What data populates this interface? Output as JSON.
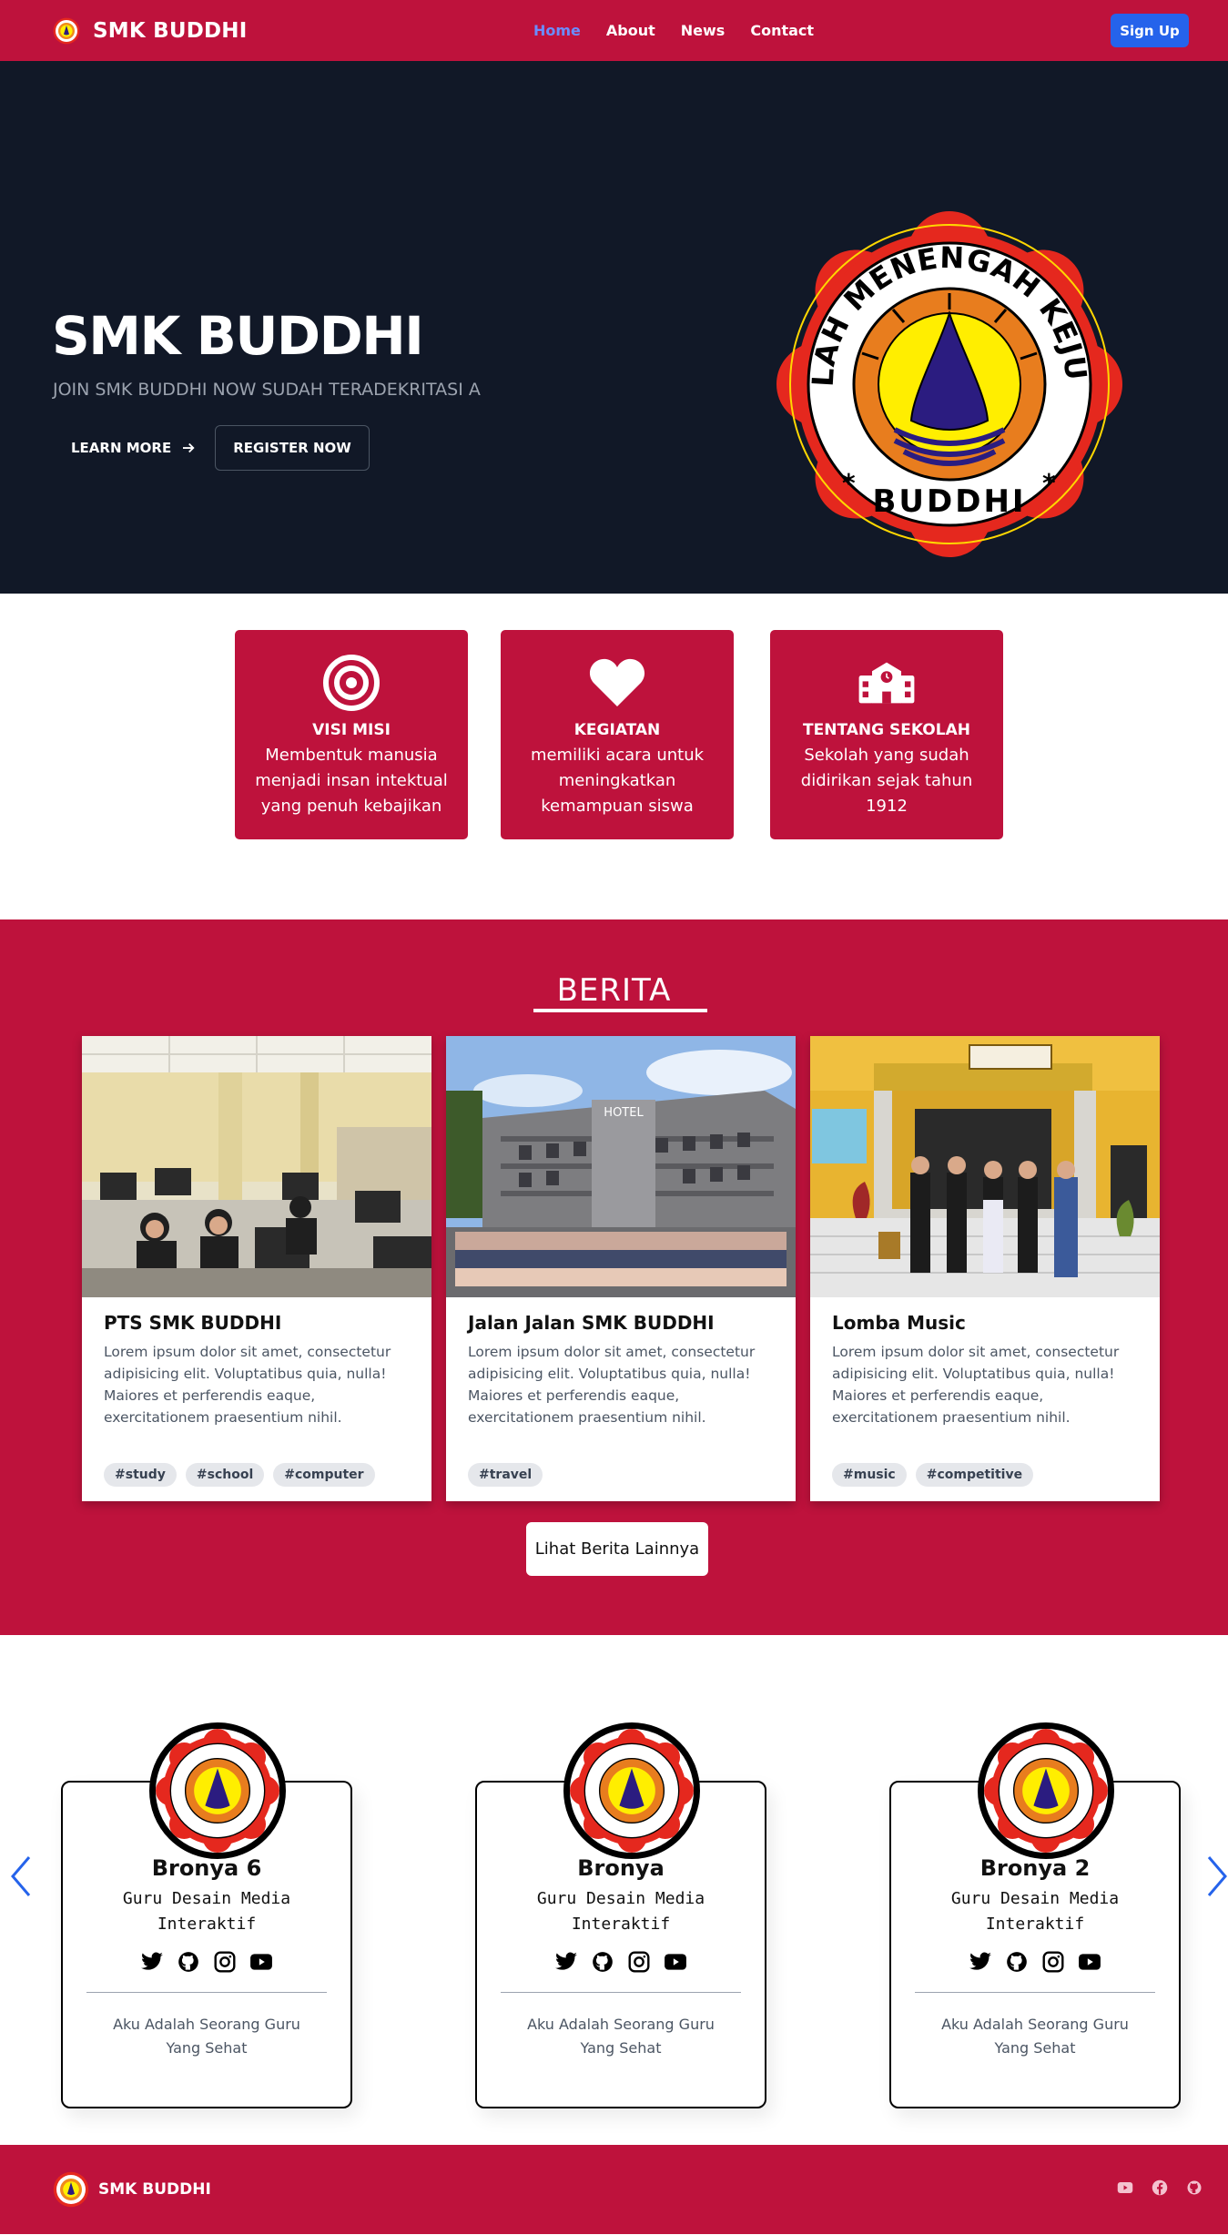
{
  "nav": {
    "brand": "SMK BUDDHI",
    "links": [
      "Home",
      "About",
      "News",
      "Contact"
    ],
    "active": "Home",
    "signup": "Sign Up"
  },
  "hero": {
    "title": "SMK BUDDHI",
    "subtitle": "JOIN SMK BUDDHI NOW SUDAH TERADEKRITASI A",
    "learn_more": "LEARN MORE",
    "register": "REGISTER NOW",
    "logo_top_text": "SEKOLAH MENENGAH KEJURUAN",
    "logo_bottom_text": "BUDDHI"
  },
  "features": [
    {
      "icon": "target-icon",
      "title": "VISI MISI",
      "text": "Membentuk manusia menjadi insan intektual yang penuh kebajikan"
    },
    {
      "icon": "heart-icon",
      "title": "KEGIATAN",
      "text": "memiliki acara untuk meningkatkan kemampuan siswa"
    },
    {
      "icon": "school-icon",
      "title": "TENTANG SEKOLAH",
      "text": "Sekolah yang sudah didirikan sejak tahun 1912"
    }
  ],
  "berita": {
    "title": "BERITA",
    "cards": [
      {
        "title": "PTS SMK BUDDHI",
        "text": "Lorem ipsum dolor sit amet, consectetur adipisicing elit. Voluptatibus quia, nulla! Maiores et perferendis eaque, exercitationem praesentium nihil.",
        "tags": [
          "#study",
          "#school",
          "#computer"
        ]
      },
      {
        "title": "Jalan Jalan SMK BUDDHI",
        "text": "Lorem ipsum dolor sit amet, consectetur adipisicing elit. Voluptatibus quia, nulla! Maiores et perferendis eaque, exercitationem praesentium nihil.",
        "tags": [
          "#travel"
        ],
        "sign_text": "HOTEL"
      },
      {
        "title": "Lomba Music",
        "text": "Lorem ipsum dolor sit amet, consectetur adipisicing elit. Voluptatibus quia, nulla! Maiores et perferendis eaque, exercitationem praesentium nihil.",
        "tags": [
          "#music",
          "#competitive"
        ]
      }
    ],
    "more_button": "Lihat Berita Lainnya"
  },
  "team": [
    {
      "name": "Bronya 6",
      "role": "Guru Desain Media Interaktif",
      "desc": "Aku Adalah Seorang Guru Yang Sehat"
    },
    {
      "name": "Bronya",
      "role": "Guru Desain Media Interaktif",
      "desc": "Aku Adalah Seorang Guru Yang Sehat"
    },
    {
      "name": "Bronya 2",
      "role": "Guru Desain Media Interaktif",
      "desc": "Aku Adalah Seorang Guru Yang Sehat"
    }
  ],
  "footer": {
    "brand": "SMK BUDDHI"
  },
  "colors": {
    "primary": "#be123c",
    "hero_bg": "#111827",
    "signup_bg": "#2563eb",
    "arrow": "#2563eb"
  }
}
